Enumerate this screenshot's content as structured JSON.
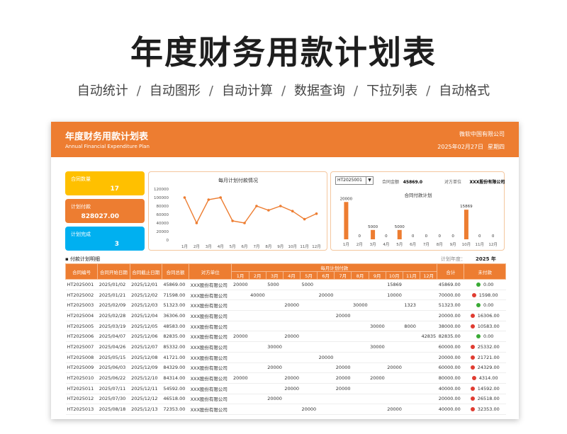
{
  "hero": {
    "title": "年度财务用款计划表",
    "features": [
      "自动统计",
      "自动图形",
      "自动计算",
      "数据查询",
      "下拉列表",
      "自动格式"
    ]
  },
  "sheet_header": {
    "title": "年度财务用款计划表",
    "subtitle": "Annual Financial Expenditure Plan",
    "company": "微软中国有限公司",
    "date": "2025年02月27日",
    "weekday": "星期四"
  },
  "cards": [
    {
      "label": "合同数量",
      "value": "17",
      "color": "#ffc000"
    },
    {
      "label": "计划付款",
      "value": "828027.00",
      "color": "#ed7d31"
    },
    {
      "label": "计划完成",
      "value": "3",
      "color": "#00b0f0"
    }
  ],
  "bar_panel": {
    "selected_contract": "HT2025001",
    "amount_label": "合同金额",
    "amount_value": "45869.0",
    "party_label": "对方单位",
    "party_value": "XXX股份有限公司"
  },
  "section": {
    "title": "付款计划明细",
    "year_label": "计划年度：",
    "year_value": "2025 年"
  },
  "table": {
    "headers": {
      "id": "合同编号",
      "start": "合同开始日期",
      "end": "合同截止日期",
      "amount": "合同总额",
      "party": "对方单位",
      "monthly": "每月计划付款",
      "total": "合计",
      "unpaid": "未付款"
    },
    "months": [
      "1月",
      "2月",
      "3月",
      "4月",
      "5月",
      "6月",
      "7月",
      "8月",
      "9月",
      "10月",
      "11月",
      "12月"
    ],
    "rows": [
      {
        "id": "HT2025001",
        "start": "2025/01/02",
        "end": "2025/12/01",
        "amount": "45869.00",
        "party": "XXX股份有限公司",
        "m": [
          "20000",
          "",
          "5000",
          "",
          "5000",
          "",
          "",
          "",
          "",
          "15869",
          "",
          ""
        ],
        "total": "45869.00",
        "status": "ok",
        "unpaid": "0.00"
      },
      {
        "id": "HT2025002",
        "start": "2025/01/21",
        "end": "2025/12/02",
        "amount": "71598.00",
        "party": "XXX股份有限公司",
        "m": [
          "",
          "40000",
          "",
          "",
          "",
          "20000",
          "",
          "",
          "",
          "10000",
          "",
          ""
        ],
        "total": "70000.00",
        "status": "bad",
        "unpaid": "1598.00"
      },
      {
        "id": "HT2025003",
        "start": "2025/02/09",
        "end": "2025/12/03",
        "amount": "51323.00",
        "party": "XXX股份有限公司",
        "m": [
          "",
          "",
          "",
          "20000",
          "",
          "",
          "",
          "30000",
          "",
          "",
          "1323",
          ""
        ],
        "total": "51323.00",
        "status": "ok",
        "unpaid": "0.00"
      },
      {
        "id": "HT2025004",
        "start": "2025/02/28",
        "end": "2025/12/04",
        "amount": "36306.00",
        "party": "XXX股份有限公司",
        "m": [
          "",
          "",
          "",
          "",
          "",
          "",
          "20000",
          "",
          "",
          "",
          "",
          ""
        ],
        "total": "20000.00",
        "status": "bad",
        "unpaid": "16306.00"
      },
      {
        "id": "HT2025005",
        "start": "2025/03/19",
        "end": "2025/12/05",
        "amount": "48583.00",
        "party": "XXX股份有限公司",
        "m": [
          "",
          "",
          "",
          "",
          "",
          "",
          "",
          "",
          "30000",
          "",
          "8000",
          ""
        ],
        "total": "38000.00",
        "status": "bad",
        "unpaid": "10583.00"
      },
      {
        "id": "HT2025006",
        "start": "2025/04/07",
        "end": "2025/12/06",
        "amount": "82835.00",
        "party": "XXX股份有限公司",
        "m": [
          "20000",
          "",
          "",
          "20000",
          "",
          "",
          "",
          "",
          "",
          "",
          "",
          "42835"
        ],
        "total": "82835.00",
        "status": "ok",
        "unpaid": "0.00"
      },
      {
        "id": "HT2025007",
        "start": "2025/04/26",
        "end": "2025/12/07",
        "amount": "85332.00",
        "party": "XXX股份有限公司",
        "m": [
          "",
          "",
          "30000",
          "",
          "",
          "",
          "",
          "",
          "30000",
          "",
          "",
          ""
        ],
        "total": "60000.00",
        "status": "bad",
        "unpaid": "25332.00"
      },
      {
        "id": "HT2025008",
        "start": "2025/05/15",
        "end": "2025/12/08",
        "amount": "41721.00",
        "party": "XXX股份有限公司",
        "m": [
          "",
          "",
          "",
          "",
          "",
          "20000",
          "",
          "",
          "",
          "",
          "",
          ""
        ],
        "total": "20000.00",
        "status": "bad",
        "unpaid": "21721.00"
      },
      {
        "id": "HT2025009",
        "start": "2025/06/03",
        "end": "2025/12/09",
        "amount": "84329.00",
        "party": "XXX股份有限公司",
        "m": [
          "",
          "",
          "20000",
          "",
          "",
          "",
          "20000",
          "",
          "",
          "20000",
          "",
          ""
        ],
        "total": "60000.00",
        "status": "bad",
        "unpaid": "24329.00"
      },
      {
        "id": "HT2025010",
        "start": "2025/06/22",
        "end": "2025/12/10",
        "amount": "84314.00",
        "party": "XXX股份有限公司",
        "m": [
          "20000",
          "",
          "",
          "20000",
          "",
          "",
          "20000",
          "",
          "20000",
          "",
          "",
          ""
        ],
        "total": "80000.00",
        "status": "bad",
        "unpaid": "4314.00"
      },
      {
        "id": "HT2025011",
        "start": "2025/07/11",
        "end": "2025/12/11",
        "amount": "54592.00",
        "party": "XXX股份有限公司",
        "m": [
          "",
          "",
          "",
          "20000",
          "",
          "",
          "20000",
          "",
          "",
          "",
          "",
          ""
        ],
        "total": "40000.00",
        "status": "bad",
        "unpaid": "14592.00"
      },
      {
        "id": "HT2025012",
        "start": "2025/07/30",
        "end": "2025/12/12",
        "amount": "46518.00",
        "party": "XXX股份有限公司",
        "m": [
          "",
          "",
          "20000",
          "",
          "",
          "",
          "",
          "",
          "",
          "",
          "",
          ""
        ],
        "total": "20000.00",
        "status": "bad",
        "unpaid": "26518.00"
      },
      {
        "id": "HT2025013",
        "start": "2025/08/18",
        "end": "2025/12/13",
        "amount": "72353.00",
        "party": "XXX股份有限公司",
        "m": [
          "",
          "",
          "",
          "",
          "20000",
          "",
          "",
          "",
          "",
          "20000",
          "",
          ""
        ],
        "total": "40000.00",
        "status": "bad",
        "unpaid": "32353.00"
      }
    ]
  },
  "chart_data": [
    {
      "type": "line",
      "title": "每月计划付款情况",
      "categories": [
        "1月",
        "2月",
        "3月",
        "4月",
        "5月",
        "6月",
        "7月",
        "8月",
        "9月",
        "10月",
        "11月",
        "12月"
      ],
      "values": [
        100000,
        40000,
        95000,
        100000,
        45000,
        40000,
        80000,
        70000,
        80000,
        68000,
        49000,
        62000
      ],
      "yticks": [
        0,
        20000,
        40000,
        60000,
        80000,
        100000,
        120000
      ],
      "ylim": [
        0,
        120000
      ],
      "color": "#ed7d31"
    },
    {
      "type": "bar",
      "title": "合同付款计划",
      "categories": [
        "1月",
        "2月",
        "3月",
        "4月",
        "5月",
        "6月",
        "7月",
        "8月",
        "9月",
        "10月",
        "11月",
        "12月"
      ],
      "values": [
        20000,
        0,
        5000,
        0,
        5000,
        0,
        0,
        0,
        0,
        15869,
        0,
        0
      ],
      "ylim": [
        0,
        22000
      ],
      "color": "#ed7d31"
    }
  ]
}
